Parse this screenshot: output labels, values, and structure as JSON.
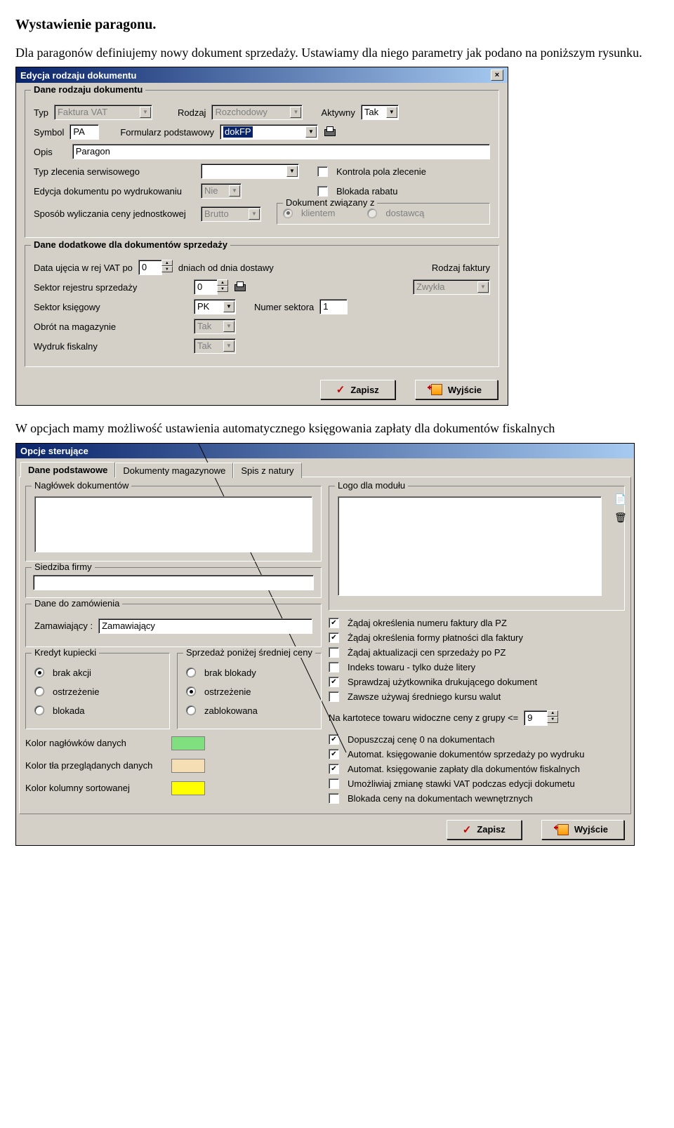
{
  "doc": {
    "heading": "Wystawienie paragonu.",
    "para1": "Dla paragonów definiujemy nowy dokument sprzedaży. Ustawiamy dla niego parametry jak podano na poniższym rysunku.",
    "para2": "W opcjach mamy  możliwość ustawienia automatycznego księgowania zapłaty dla dokumentów fiskalnych"
  },
  "dlg1": {
    "title": "Edycja rodzaju dokumentu",
    "g1": "Dane rodzaju dokumentu",
    "typ_lbl": "Typ",
    "typ_val": "Faktura VAT",
    "rodzaj_lbl": "Rodzaj",
    "rodzaj_val": "Rozchodowy",
    "aktywny_lbl": "Aktywny",
    "aktywny_val": "Tak",
    "symbol_lbl": "Symbol",
    "symbol_val": "PA",
    "form_lbl": "Formularz podstawowy",
    "form_val": "dokFP",
    "opis_lbl": "Opis",
    "opis_val": "Paragon",
    "typzlec_lbl": "Typ zlecenia serwisowego",
    "kontrola_lbl": "Kontrola pola zlecenie",
    "edycja_lbl": "Edycja dokumentu po wydrukowaniu",
    "edycja_val": "Nie",
    "blokada_lbl": "Blokada rabatu",
    "sposob_lbl": "Sposób wyliczania ceny jednostkowej",
    "sposob_val": "Brutto",
    "dokzw_lbl": "Dokument związany z",
    "klient_lbl": "klientem",
    "dostawca_lbl": "dostawcą",
    "g2": "Dane dodatkowe dla dokumentów sprzedaży",
    "datavat_lbl": "Data ujęcia w rej VAT po",
    "datavat_val": "0",
    "dniach_lbl": "dniach od dnia dostawy",
    "rodzfakt_lbl": "Rodzaj faktury",
    "rodzfakt_val": "Zwykła",
    "sektor_rej_lbl": "Sektor rejestru sprzedaży",
    "sektor_rej_val": "0",
    "sektor_ks_lbl": "Sektor księgowy",
    "sektor_ks_val": "PK",
    "numer_sek_lbl": "Numer sektora",
    "numer_sek_val": "1",
    "obrot_lbl": "Obrót na magazynie",
    "obrot_val": "Tak",
    "wydruk_lbl": "Wydruk fiskalny",
    "wydruk_val": "Tak",
    "zapisz": "Zapisz",
    "wyjscie": "Wyjście"
  },
  "dlg2": {
    "title": "Opcje sterujące",
    "tabs": [
      "Dane podstawowe",
      "Dokumenty magazynowe",
      "Spis z natury"
    ],
    "naglowek_lbl": "Nagłówek dokumentów",
    "logo_lbl": "Logo dla modułu",
    "siedziba_lbl": "Siedziba firmy",
    "danezam_lbl": "Dane do zamówienia",
    "zam_lbl": "Zamawiający :",
    "zam_val": "Zamawiający",
    "kredyt_lbl": "Kredyt kupiecki",
    "sprzedaz_lbl": "Sprzedaż poniżej średniej ceny",
    "radio_kredyt": [
      "brak akcji",
      "ostrzeżenie",
      "blokada"
    ],
    "radio_sprzedaz": [
      "brak blokady",
      "ostrzeżenie",
      "zablokowana"
    ],
    "kolor1_lbl": "Kolor nagłówków danych",
    "kolor2_lbl": "Kolor tła przeglądanych danych",
    "kolor3_lbl": "Kolor kolumny sortowanej",
    "kolor1": "#80e080",
    "kolor2": "#f5deb3",
    "kolor3": "#ffff00",
    "checks": [
      {
        "on": true,
        "t": "Żądaj określenia numeru faktury dla PZ"
      },
      {
        "on": true,
        "t": "Żądaj określenia formy płatności dla faktury"
      },
      {
        "on": false,
        "t": "Żądaj aktualizacji cen sprzedaży po PZ"
      },
      {
        "on": false,
        "t": "Indeks towaru - tylko duże litery"
      },
      {
        "on": true,
        "t": "Sprawdzaj użytkownika drukującego dokument"
      },
      {
        "on": false,
        "t": "Zawsze używaj średniego kursu walut"
      }
    ],
    "kartotece_pre": "Na kartotece towaru widoczne ceny z grupy <=",
    "kartotece_val": "9",
    "checks2": [
      {
        "on": true,
        "t": "Dopuszczaj cenę 0 na dokumentach"
      },
      {
        "on": true,
        "t": "Automat. księgowanie dokumentów sprzedaży po wydruku"
      },
      {
        "on": true,
        "t": "Automat. księgowanie zapłaty dla dokumentów fiskalnych"
      },
      {
        "on": false,
        "t": "Umożliwiaj zmianę stawki VAT podczas edycji dokumetu"
      },
      {
        "on": false,
        "t": "Blokada ceny na dokumentach wewnętrznych"
      }
    ],
    "zapisz": "Zapisz",
    "wyjscie": "Wyjście"
  }
}
